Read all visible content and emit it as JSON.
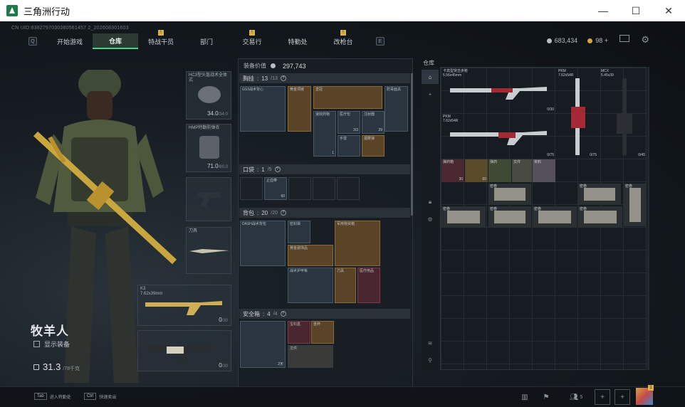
{
  "window": {
    "title": "三角洲行动",
    "controls": {
      "minimize": "—",
      "maximize": "☐",
      "close": "✕"
    }
  },
  "header": {
    "uid": "CN UID:8382797030380561457 2_202608301603",
    "left_key": "Q",
    "right_key": "E",
    "tabs": [
      {
        "label": "开始游戏",
        "active": false,
        "badge": ""
      },
      {
        "label": "仓库",
        "active": true,
        "badge": ""
      },
      {
        "label": "特战干员",
        "active": false,
        "badge": "!"
      },
      {
        "label": "部门",
        "active": false,
        "badge": ""
      },
      {
        "label": "交易行",
        "active": false,
        "badge": "!"
      },
      {
        "label": "特勤处",
        "active": false,
        "badge": ""
      },
      {
        "label": "改枪台",
        "active": false,
        "badge": "!"
      }
    ],
    "currency": {
      "silver": "683,434",
      "gold": "98",
      "gold_add": "+"
    },
    "icons": [
      "mail-icon",
      "settings-icon"
    ],
    "colors": {
      "accent": "#3fd486",
      "badge": "#d8b04a"
    }
  },
  "operator": {
    "name": "牧羊人",
    "show_gear_label": "显示装备",
    "weight": "31.3",
    "weight_max": "/78千克"
  },
  "equipment": {
    "helmet": {
      "name": "HC3型头盔战术全体式",
      "durability": "34.0",
      "max": "/34.0"
    },
    "armor": {
      "name": "HMP特勤防弹衣",
      "durability": "71.0",
      "max": "/80.0"
    },
    "pistol": {
      "name": ""
    },
    "melee": {
      "name": "刀具"
    },
    "primary": {
      "name": "K3",
      "caliber": "7.62x39mm",
      "ammo": "0",
      "ammo_max": "/30"
    },
    "secondary": {
      "name": "",
      "ammo": "0",
      "ammo_max": "/30"
    }
  },
  "inventory": {
    "equip_value_label": "装备价值",
    "equip_value": "297,743",
    "rig": {
      "label": "胸挂",
      "used": "13",
      "cap": "/13"
    },
    "pocket": {
      "label": "口袋",
      "used": "1",
      "cap": "/5"
    },
    "backpack": {
      "label": "背包",
      "used": "20",
      "cap": "/20"
    },
    "safebox": {
      "label": "安全箱",
      "used": "4",
      "cap": "/4",
      "timer": "2天"
    },
    "rig_items": [
      {
        "name": "GS3战术背心",
        "count": ""
      },
      {
        "name": "黄金项链",
        "count": ""
      },
      {
        "name": "皇冠",
        "count": ""
      },
      {
        "name": "防毒面具",
        "count": ""
      },
      {
        "name": "速效药物",
        "count": "1"
      },
      {
        "name": "医疗包",
        "count": "3/3"
      },
      {
        "name": "注射器",
        "count": "29"
      },
      {
        "name": "手雷",
        "count": ""
      },
      {
        "name": "烟雾弹",
        "count": ""
      }
    ],
    "pocket_items": [
      {
        "name": "止血带",
        "count": "60"
      }
    ],
    "backpack_items": [
      {
        "name": "DASH战术背包",
        "count": ""
      },
      {
        "name": "密封袋",
        "count": ""
      },
      {
        "name": "黄金装饰品",
        "count": ""
      },
      {
        "name": "军用物资箱",
        "count": ""
      },
      {
        "name": "战术护甲板",
        "count": ""
      },
      {
        "name": "刀具",
        "count": ""
      },
      {
        "name": "医疗用品",
        "count": ""
      }
    ],
    "safebox_items": [
      {
        "name": "宝石盒",
        "count": ""
      },
      {
        "name": "金杯",
        "count": ""
      },
      {
        "name": "文件",
        "count": ""
      }
    ]
  },
  "warehouse": {
    "title": "仓库",
    "items": [
      {
        "name": "卡宾型突击步枪",
        "caliber": "5.56x45mm",
        "count": "0/30"
      },
      {
        "name": "PKM",
        "caliber": "7.62x54R",
        "count": "0/75"
      },
      {
        "name": "MCX",
        "caliber": "5.45x39",
        "count": "0/45"
      },
      {
        "name": "PKM",
        "caliber": "7.62x54R",
        "count": "0/75"
      },
      {
        "name": "弹药箱",
        "count": "30"
      },
      {
        "name": "弹药",
        "count": "60"
      },
      {
        "name": "文件",
        "count": ""
      },
      {
        "name": "资料",
        "count": ""
      }
    ],
    "paper_labels": [
      "密卷",
      "密卷",
      "密卷",
      "密卷",
      "密卷",
      "密卷",
      "密卷",
      "密卷",
      "密卷"
    ],
    "sidebar_icons": [
      "home-icon",
      "plus-icon",
      "lock-icon",
      "gear-icon",
      "layers-icon",
      "link-icon"
    ]
  },
  "bottom": {
    "hint1_key": "Tab",
    "hint1": "进入特勤处",
    "hint2_key": "Ctrl",
    "hint2": "快速卖出",
    "friends_count": "5",
    "avatar_badge": "1"
  }
}
